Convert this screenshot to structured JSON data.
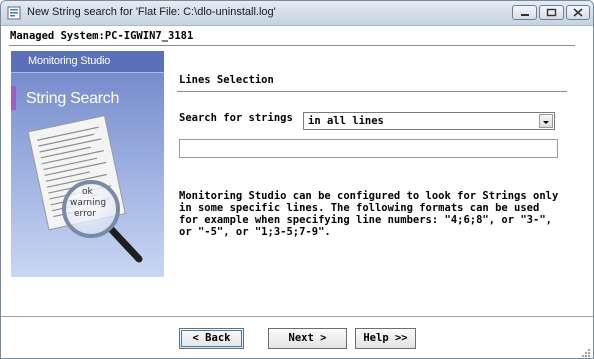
{
  "window": {
    "title": "New String search for 'Flat File: C:\\dlo-uninstall.log'",
    "controls": [
      "minimize-icon",
      "maximize-icon",
      "close-icon"
    ]
  },
  "header": {
    "managed_system": "Managed System:PC-IGWIN7_3181"
  },
  "banner": {
    "product": "Monitoring Studio",
    "title": "String Search",
    "magnifier_words": [
      "ok",
      "warning",
      "error"
    ]
  },
  "section": {
    "title": "Lines Selection"
  },
  "search": {
    "label": "Search for strings",
    "selected": "in all lines",
    "lines_value": ""
  },
  "description": {
    "lines": [
      "Monitoring Studio can be configured to look for Strings only",
      "in some specific lines. The following formats can be used",
      "for example when specifying line numbers: \"4;6;8\", or \"3-\",",
      "or \"-5\", or \"1;3-5;7-9\"."
    ]
  },
  "buttons": {
    "back": "< Back",
    "next": "Next >",
    "help": "Help >>"
  },
  "colors": {
    "banner_top": "#6f84c8",
    "banner_bottom": "#c9d6f3",
    "accent_bar": "#9a5fc4",
    "title_bar": "#d3deea"
  }
}
